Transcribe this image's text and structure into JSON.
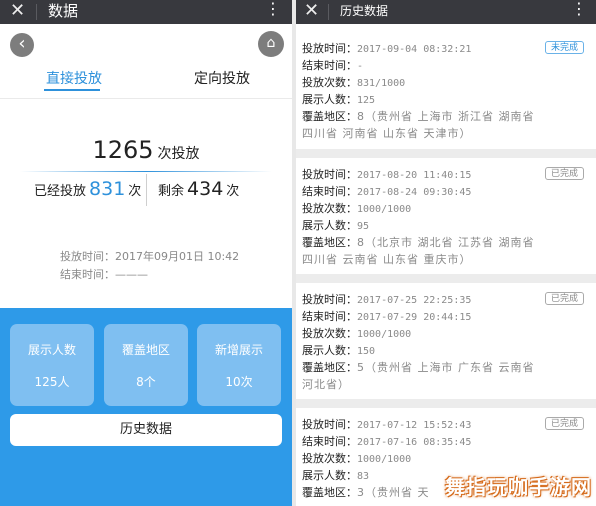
{
  "left": {
    "title": "数据",
    "close_glyph": "✕",
    "more_glyph": "⋮",
    "back_glyph": "‹",
    "home_glyph": "⌂",
    "tabs": [
      {
        "label": "直接投放",
        "active": true
      },
      {
        "label": "定向投放",
        "active": false
      }
    ],
    "total": {
      "value": "1265",
      "unit": "次投放"
    },
    "delivered": {
      "label": "已经投放",
      "value": "831",
      "unit": "次"
    },
    "remaining": {
      "label": "剩余",
      "value": "434",
      "unit": "次"
    },
    "start_time": "投放时间：2017年09月01日 10:42",
    "end_time": "结束时间：———",
    "cards": [
      {
        "label": "展示人数",
        "value": "125人"
      },
      {
        "label": "覆盖地区",
        "value": "8个"
      },
      {
        "label": "新增展示",
        "value": "10次"
      }
    ],
    "history_button": "历史数据"
  },
  "right": {
    "title": "历史数据",
    "close_glyph": "✕",
    "more_glyph": "⋮",
    "keys": {
      "start": "投放时间：",
      "end": "结束时间：",
      "count": "投放次数：",
      "people": "展示人数：",
      "regions": "覆盖地区："
    },
    "records": [
      {
        "status": "未完成",
        "start": "2017-09-04 08:32:21",
        "end": "-",
        "count": "831/1000",
        "people": "125",
        "regions_line1": "8（贵州省  上海市  浙江省  湖南省",
        "regions_line2": "四川省  河南省  山东省  天津市）"
      },
      {
        "status": "已完成",
        "start": "2017-08-20 11:40:15",
        "end": "2017-08-24 09:30:45",
        "count": "1000/1000",
        "people": "95",
        "regions_line1": "8（北京市  湖北省  江苏省  湖南省",
        "regions_line2": "四川省  云南省  山东省  重庆市）"
      },
      {
        "status": "已完成",
        "start": "2017-07-25 22:25:35",
        "end": "2017-07-29 20:44:15",
        "count": "1000/1000",
        "people": "150",
        "regions_line1": "5（贵州省  上海市  广东省  云南省",
        "regions_line2": "河北省）"
      },
      {
        "status": "已完成",
        "start": "2017-07-12 15:52:43",
        "end": "2017-07-16 08:35:45",
        "count": "1000/1000",
        "people": "83",
        "regions_line1": "3（贵州省  天",
        "regions_line2": ""
      }
    ]
  },
  "watermark": "舞指玩咖手游网",
  "colors": {
    "accent": "#2e91db",
    "topbar": "#38393e",
    "blue_area": "#2e9ae8",
    "card": "#7fbff1"
  }
}
